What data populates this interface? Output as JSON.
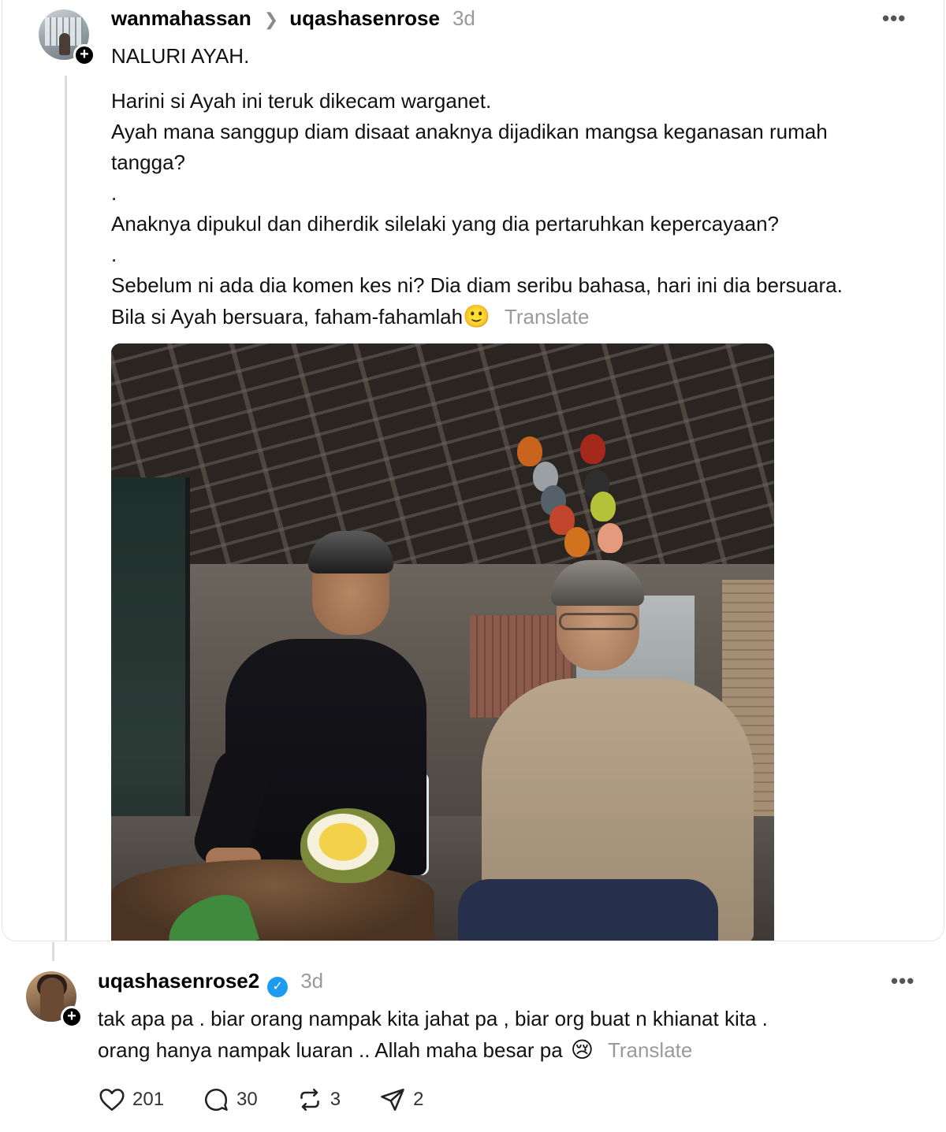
{
  "quoted_post": {
    "username": "wanmahassan",
    "reply_to": "uqashasenrose",
    "time": "3d",
    "more_label": "•••",
    "lines": [
      "NALURI AYAH.",
      "Harini si Ayah ini teruk dikecam warganet.",
      "Ayah mana sanggup diam disaat anaknya dijadikan mangsa keganasan rumah",
      "tangga?",
      ".",
      "Anaknya dipukul dan diherdik silelaki yang dia pertaruhkan kepercayaan?",
      ".",
      "Sebelum ni ada dia komen kes ni? Dia diam seribu bahasa, hari ini dia bersuara.",
      "Bila si Ayah bersuara, faham-fahamlah"
    ],
    "last_line_emoji": "🙂",
    "translate_label": "Translate",
    "avatar_icon": "profile-photo-icon",
    "follow_icon": "plus-icon"
  },
  "reply_post": {
    "username": "uqashasenrose2",
    "verified_icon": "verified-badge-icon",
    "time": "3d",
    "more_label": "•••",
    "lines": [
      "tak apa pa . biar orang nampak kita jahat pa , biar org buat n khianat kita .",
      "orang hanya nampak luaran .. Allah maha besar pa"
    ],
    "last_line_emoji": "😢",
    "translate_label": "Translate",
    "actions": {
      "likes": "201",
      "comments": "30",
      "reposts": "3",
      "shares": "2"
    }
  },
  "colors": {
    "verified": "#1d9bf0",
    "muted_text": "#999999",
    "thread_line": "#dcdcdc"
  }
}
